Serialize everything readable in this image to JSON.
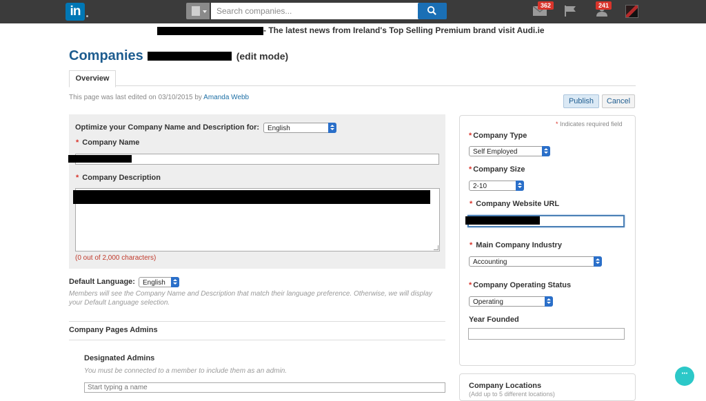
{
  "topbar": {
    "logo_text": "in",
    "search_placeholder": "Search companies...",
    "messages_count": "362",
    "notifications_count": "241",
    "icons": [
      "linkedin-logo",
      "building-icon",
      "search-icon",
      "mail-icon",
      "flag-icon",
      "people-icon",
      "avatar"
    ]
  },
  "ad": {
    "text": "- The latest news from Ireland's Top Selling Premium brand visit Audi.ie"
  },
  "page": {
    "title": "Companies",
    "mode": "(edit mode)",
    "tab_overview": "Overview",
    "edited_prefix": "This page was last edited on 03/10/2015 by",
    "edited_by": "Amanda Webb",
    "publish_label": "Publish",
    "cancel_label": "Cancel"
  },
  "left": {
    "optimize_label": "Optimize your Company Name and Description for:",
    "optimize_value": "English",
    "company_name_label": "Company Name",
    "company_description_label": "Company Description",
    "char_counter": "(0 out of 2,000 characters)",
    "default_language_label": "Default Language:",
    "default_language_value": "English",
    "language_help": "Members will see the Company Name and Description that match their language preference. Otherwise, we will display your Default Language selection.",
    "admins_heading": "Company Pages Admins",
    "designated_admins_label": "Designated Admins",
    "designated_help": "You must be connected to a member to include them as an admin.",
    "admin_placeholder": "Start typing a name"
  },
  "right": {
    "required_note": "Indicates required field",
    "required_mark": "*",
    "company_type_label": "Company Type",
    "company_type_value": "Self Employed",
    "company_size_label": "Company Size",
    "company_size_value": "2-10",
    "website_label": "Company Website URL",
    "industry_label": "Main Company Industry",
    "industry_value": "Accounting",
    "status_label": "Company Operating Status",
    "status_value": "Operating",
    "year_label": "Year Founded",
    "locations_heading": "Company Locations",
    "locations_sub": "(Add up to 5 different locations)"
  },
  "colors": {
    "topbar": "#3b3b3b",
    "brand_blue": "#0077b5",
    "title_blue": "#1d5c8f",
    "required_red": "#d9342b",
    "panel_gray": "#eeeeee"
  }
}
